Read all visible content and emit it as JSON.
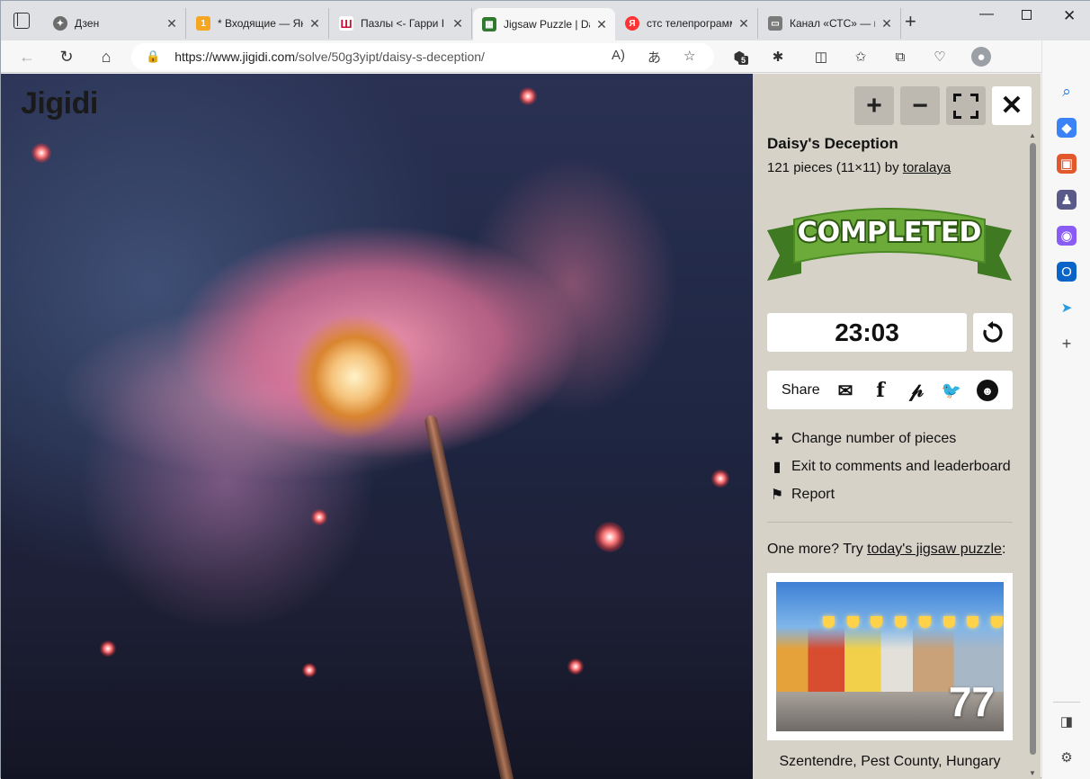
{
  "browser": {
    "tabs": [
      {
        "title": "Дзен",
        "favicon_color": "#6c6c6c",
        "active": false
      },
      {
        "title": "* Входящие — Ян",
        "favicon_color": "#f5a623",
        "favicon_badge": "1",
        "active": false
      },
      {
        "title": "Пазлы <- Гарри I",
        "favicon_color": "#c8102e",
        "active": false
      },
      {
        "title": "Jigsaw Puzzle | Da",
        "favicon_color": "#2f7a2f",
        "active": true
      },
      {
        "title": "стс телепрограмм",
        "favicon_color": "#f33",
        "active": false
      },
      {
        "title": "Канал «СТС» — п",
        "favicon_color": "#7a7a7a",
        "active": false
      }
    ],
    "url_host": "https://www.jigidi.com",
    "url_path": "/solve/50g3yipt/daisy-s-deception/",
    "extension_badge": "5"
  },
  "site": {
    "logo": "Jigidi"
  },
  "puzzle": {
    "title": "Daisy's Deception",
    "info_prefix": "121 pieces (11×11) by ",
    "author": "toralaya",
    "status": "COMPLETED",
    "timer": "23:03"
  },
  "controls": {
    "zoom_in": "+",
    "zoom_out": "−",
    "close": "✕"
  },
  "share": {
    "label": "Share"
  },
  "menu": [
    {
      "label": "Change number of pieces",
      "icon": "puzzle-piece-icon"
    },
    {
      "label": "Exit to comments and leaderboard",
      "icon": "exit-door-icon"
    },
    {
      "label": "Report",
      "icon": "flag-icon"
    }
  ],
  "promo": {
    "prefix": "One more? Try ",
    "link": "today's jigsaw puzzle",
    "suffix": ":",
    "day_number": "77",
    "caption": "Szentendre, Pest County, Hungary"
  }
}
